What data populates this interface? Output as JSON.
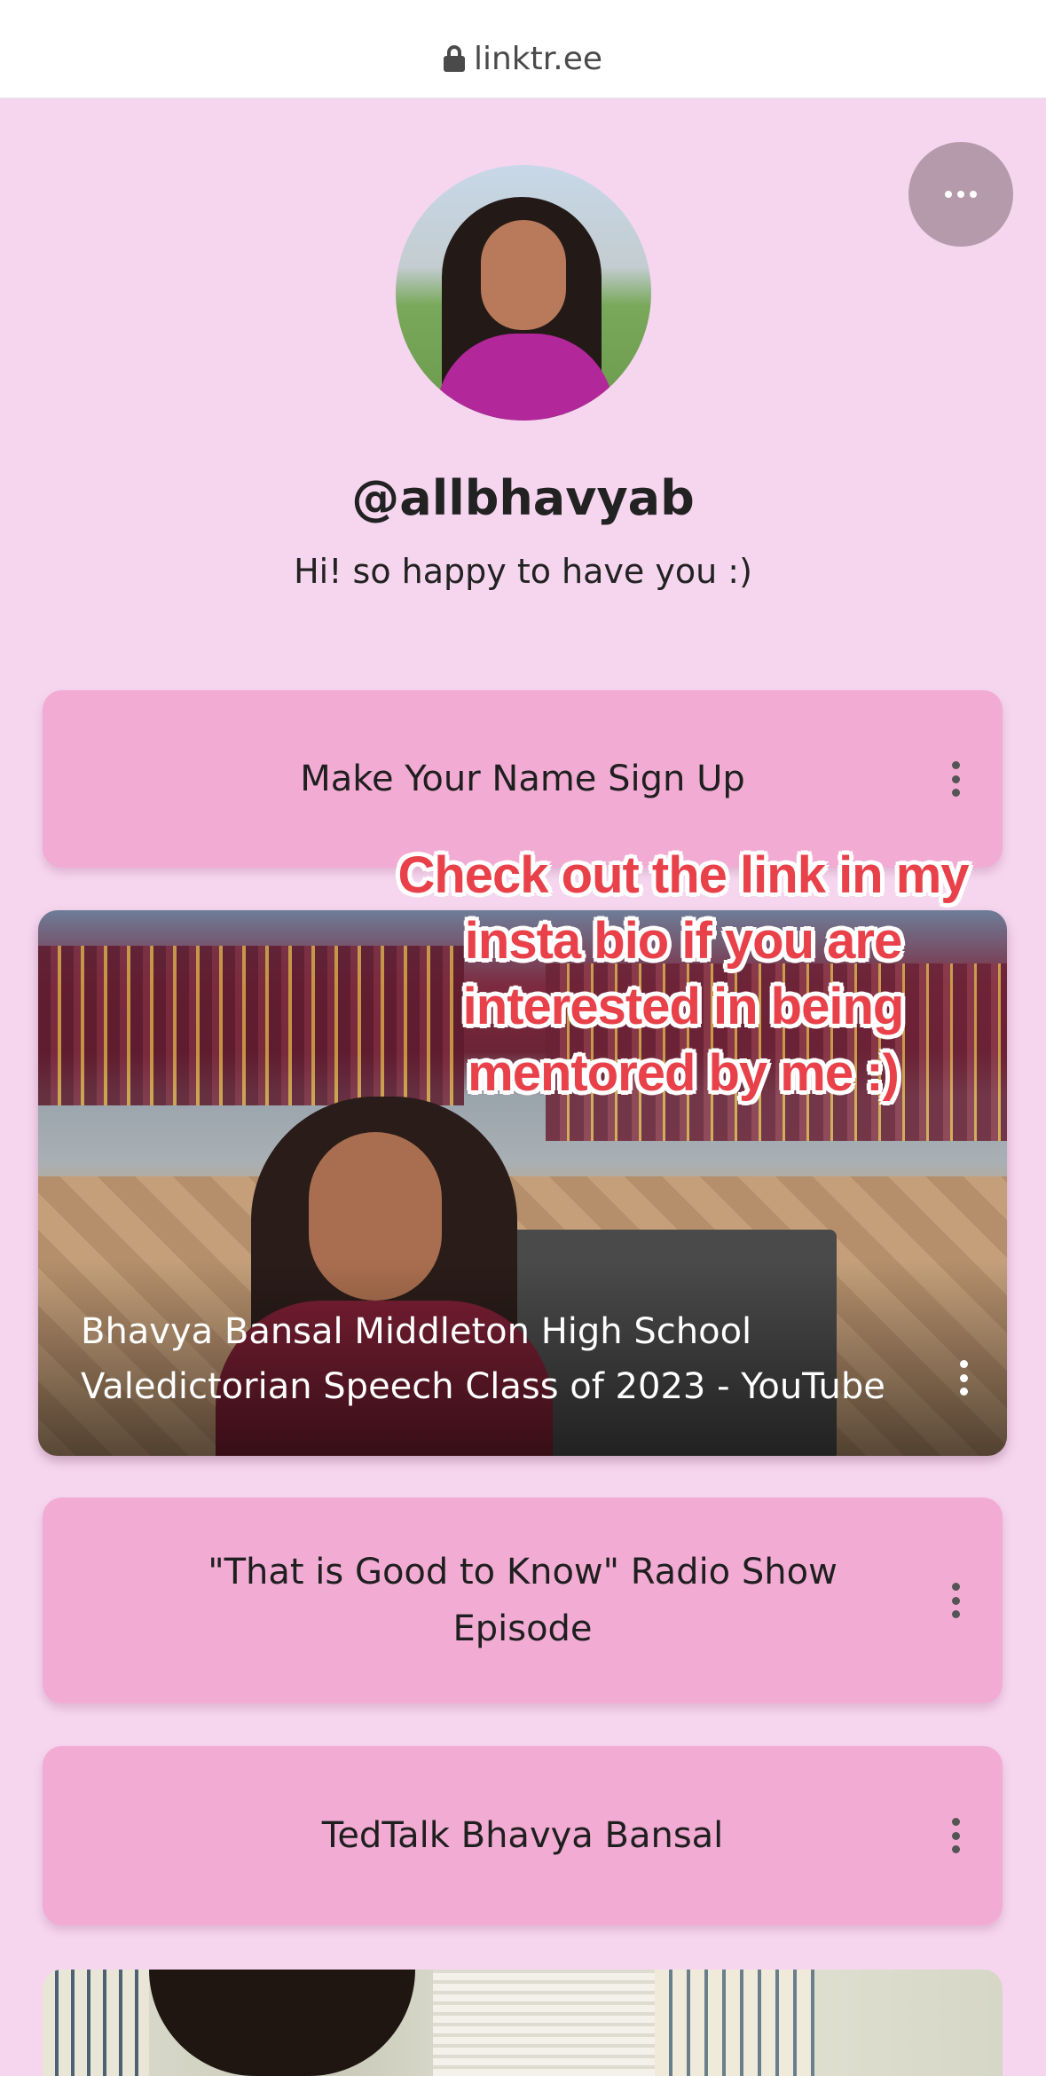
{
  "browser": {
    "url": "linktr.ee"
  },
  "profile": {
    "username": "@allbhavyab",
    "bio": "Hi! so happy to have you :)"
  },
  "links": [
    {
      "label": "Make Your Name Sign Up"
    },
    {
      "label": "Bhavya Bansal Middleton High School Valedictorian Speech Class of 2023 - YouTube",
      "type": "video"
    },
    {
      "label": "\"That is Good to Know\" Radio Show Episode"
    },
    {
      "label": "TedTalk Bhavya Bansal"
    }
  ],
  "overlay": {
    "caption": "Check out the link in my insta bio if you are interested in being mentored by me :)"
  },
  "colors": {
    "background": "#f6d6ef",
    "button": "#f2acd4",
    "overlay_text": "#e8414a"
  }
}
